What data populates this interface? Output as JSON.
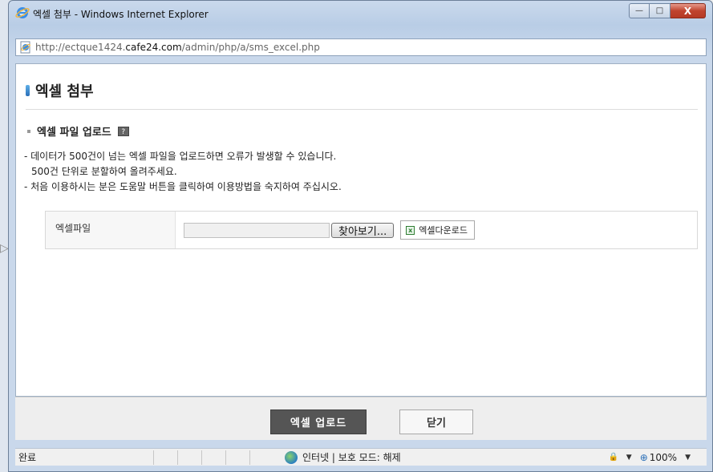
{
  "window": {
    "title": "엑셀 첨부 - Windows Internet Explorer",
    "url_prefix": "http://ectque1424.",
    "url_host": "cafe24.com",
    "url_path": "/admin/php/a/sms_excel.php"
  },
  "page": {
    "title": "엑셀 첨부",
    "section_title": "엑셀 파일 업로드",
    "help_icon_label": "?",
    "notes": [
      "- 데이터가 500건이 넘는 엑셀 파일을 업로드하면 오류가 발생할 수 있습니다.",
      "  500건 단위로 분할하여 올려주세요.",
      "- 처음 이용하시는 분은 도움말 버튼을 클릭하여 이용방법을 숙지하여 주십시오."
    ],
    "form": {
      "label": "엑셀파일",
      "file_value": "",
      "browse_label": "찾아보기...",
      "excel_download_label": "엑셀다운로드"
    },
    "buttons": {
      "upload": "엑셀 업로드",
      "close": "닫기"
    }
  },
  "status": {
    "text": "완료",
    "zone": "인터넷 | 보호 모드: 해제",
    "zoom": "100%"
  },
  "icons": {
    "ie": "ie-logo-icon",
    "page": "page-icon",
    "globe": "globe-icon",
    "excel": "excel-icon"
  },
  "colors": {
    "upload_button_bg": "#555555",
    "title_mark": "#2a6fb8"
  }
}
